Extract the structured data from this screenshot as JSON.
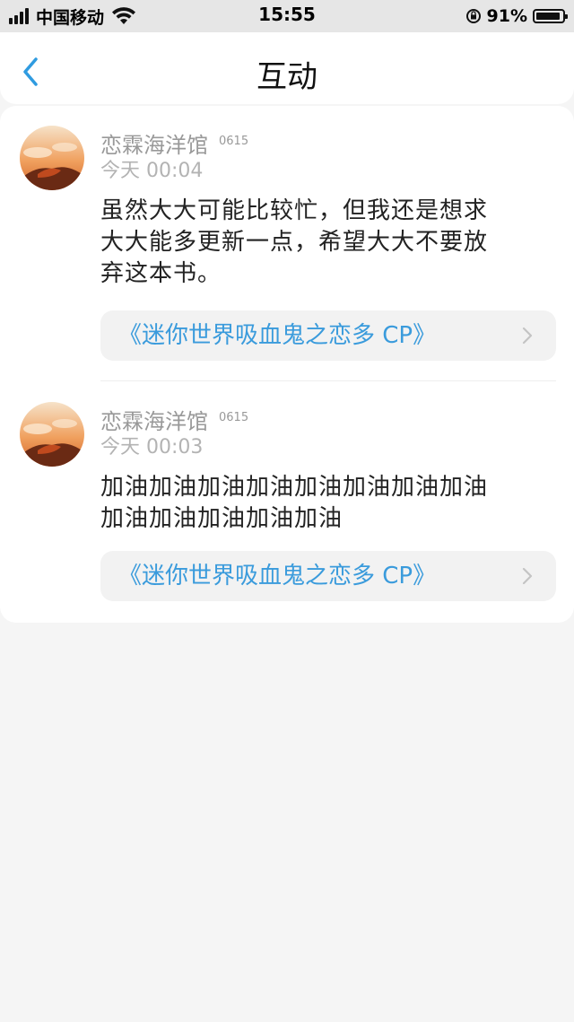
{
  "status_bar": {
    "carrier": "中国移动",
    "time": "15:55",
    "battery": "91%"
  },
  "nav": {
    "title": "互动"
  },
  "comments": [
    {
      "username": "恋霖海洋馆",
      "badge": "0615",
      "time": "今天 00:04",
      "lines": [
        "虽然大大可能比较忙，但我还是想求",
        "大大能多更新一点，希望大大不要放",
        "弃这本书。"
      ],
      "book": "《迷你世界吸血鬼之恋多 CP》"
    },
    {
      "username": "恋霖海洋馆",
      "badge": "0615",
      "time": "今天 00:03",
      "lines": [
        "加油加油加油加油加油加油加油加油",
        "加油加油加油加油加油"
      ],
      "book": "《迷你世界吸血鬼之恋多 CP》"
    }
  ],
  "colors": {
    "link": "#3a9bdc",
    "accent_back": "#2f9be0"
  }
}
